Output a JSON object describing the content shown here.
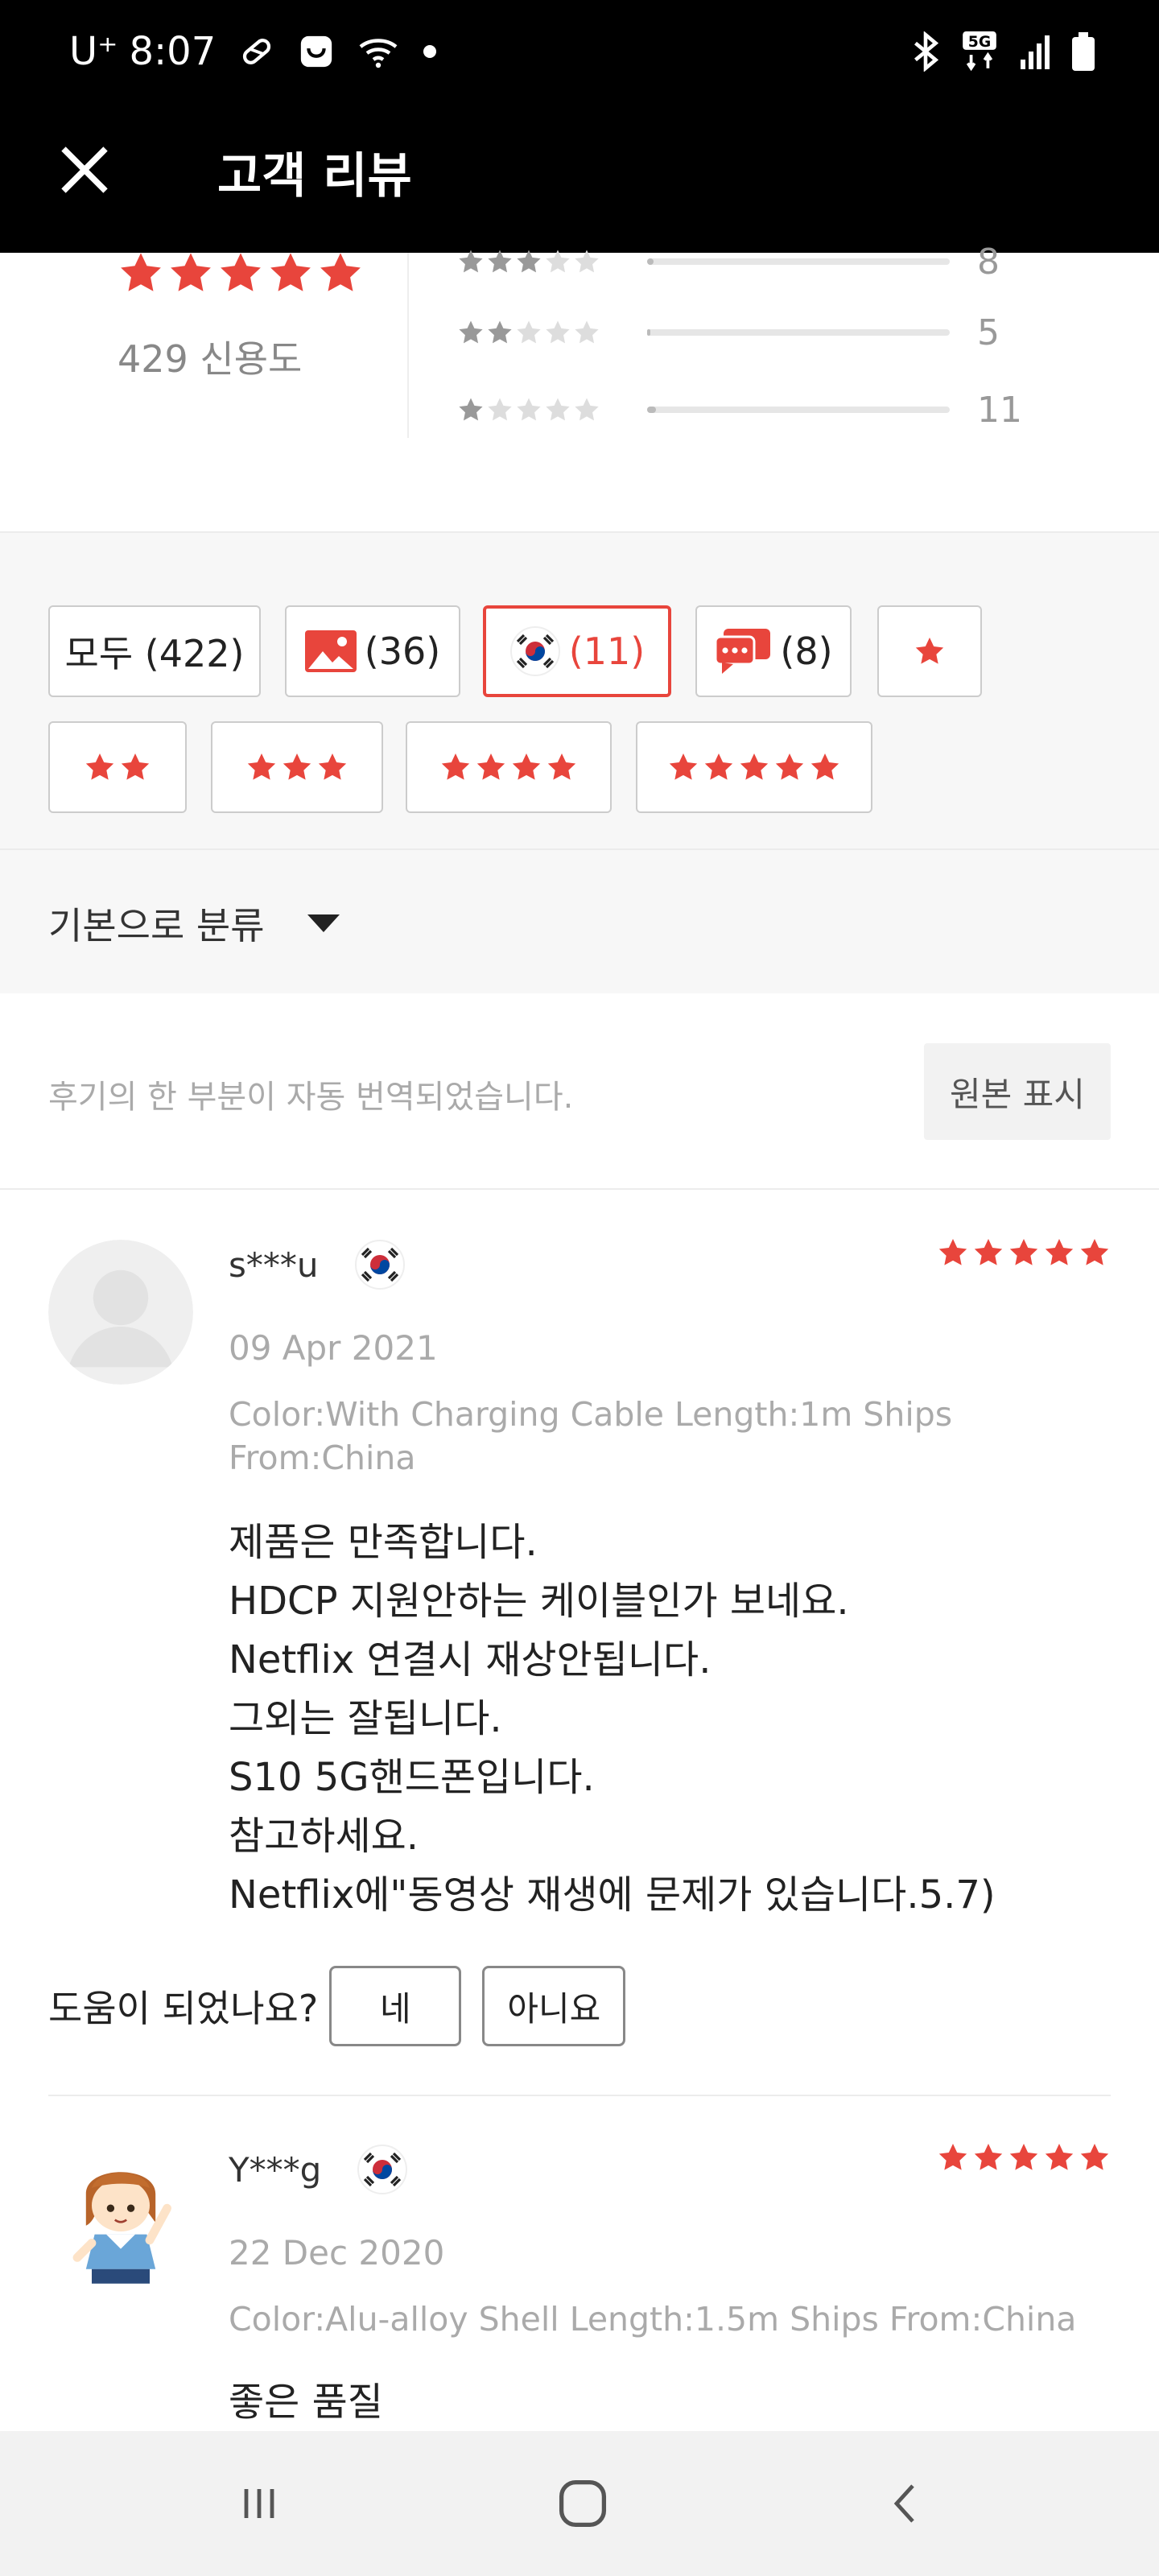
{
  "status_bar": {
    "carrier": "U⁺",
    "time": "8:07",
    "icons_left": [
      "pill-icon",
      "shopping-bag-icon",
      "wifi-icon",
      "dot-icon"
    ],
    "icons_right": [
      "bluetooth-icon",
      "5g-icon",
      "signal-icon",
      "battery-icon"
    ]
  },
  "header": {
    "title": "고객 리뷰",
    "close_icon": "close-icon"
  },
  "summary": {
    "overall_stars": 5,
    "credit_text": "429 신용도",
    "distribution": [
      {
        "stars": 3,
        "count": "8",
        "fill": 0.02
      },
      {
        "stars": 2,
        "count": "5",
        "fill": 0.01
      },
      {
        "stars": 1,
        "count": "11",
        "fill": 0.03
      }
    ]
  },
  "filters": {
    "all": "모두 (422)",
    "photo": "(36)",
    "country": "(11)",
    "comments": "(8)",
    "star_filters": [
      1,
      2,
      3,
      4,
      5
    ]
  },
  "sort": {
    "label": "기본으로 분류"
  },
  "notice": {
    "text": "후기의 한 부분이 자동 번역되었습니다.",
    "button": "원본 표시"
  },
  "reviews": [
    {
      "user": "s***u",
      "stars": 5,
      "date": "09 Apr 2021",
      "meta": "Color:With Charging Cable Length:1m Ships From:China",
      "body": "제품은 만족합니다.\nHDCP 지원안하는 케이블인가 보네요.\nNetflix 연결시 재상안됩니다.\n그외는 잘됩니다.\nS10 5G핸드폰입니다.\n참고하세요.\nNetflix에\"동영상 재생에 문제가 있습니다.5.7)",
      "helpful_q": "도움이 되었나요?",
      "yes": "네",
      "no": "아니요"
    },
    {
      "user": "Y***g",
      "stars": 5,
      "date": "22 Dec 2020",
      "meta": "Color:Alu-alloy Shell Length:1.5m Ships From:China",
      "body": "좋은 품질"
    }
  ],
  "nav": {
    "recents": "recents-icon",
    "home": "home-icon",
    "back": "back-icon"
  },
  "colors": {
    "accent": "#e8453c",
    "star_inactive": "#d5d5d5"
  }
}
